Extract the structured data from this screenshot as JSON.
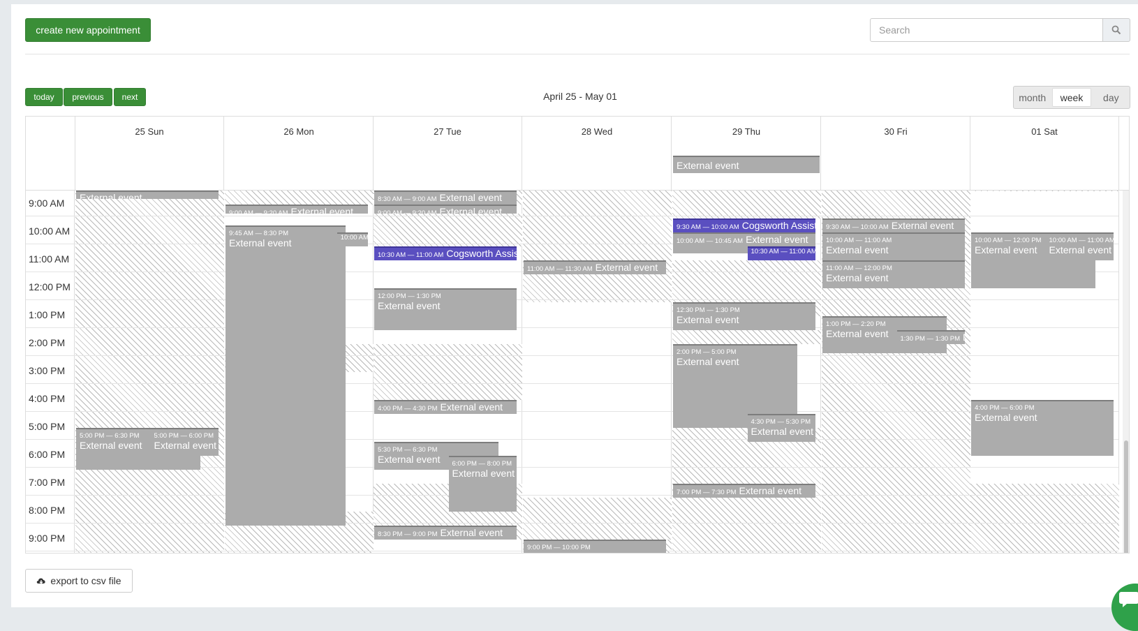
{
  "toolbar": {
    "create_label": "create new appointment",
    "search_placeholder": "Search",
    "today_label": "today",
    "previous_label": "previous",
    "next_label": "next",
    "range_title": "April 25 - May 01",
    "views": [
      "month",
      "week",
      "day"
    ],
    "active_view": "week"
  },
  "calendar": {
    "days": [
      "25 Sun",
      "26 Mon",
      "27 Tue",
      "28 Wed",
      "29 Thu",
      "30 Fri",
      "01 Sat"
    ],
    "hours": [
      "9:00 AM",
      "10:00 AM",
      "11:00 AM",
      "12:00 PM",
      "1:00 PM",
      "2:00 PM",
      "3:00 PM",
      "4:00 PM",
      "5:00 PM",
      "6:00 PM",
      "7:00 PM",
      "8:00 PM",
      "9:00 PM"
    ],
    "all_day_event": {
      "day": 4,
      "title": "External event"
    },
    "events": [
      {
        "day": 0,
        "start": 8.3,
        "end": 8.8,
        "time": "",
        "title": "External event",
        "col": 0,
        "cols": 1
      },
      {
        "day": 0,
        "start": 17.0,
        "end": 18.5,
        "time": "5:00 PM — 6:30 PM",
        "title": "External event",
        "col": 0,
        "cols": 2,
        "wide": 1.7
      },
      {
        "day": 0,
        "start": 17.0,
        "end": 18.0,
        "time": "5:00 PM — 6:00 PM",
        "title": "External event",
        "col": 1,
        "cols": 2
      },
      {
        "day": 1,
        "start": 9.0,
        "end": 9.333,
        "time": "9:00 AM — 9:20 AM",
        "title": "External event",
        "col": 0,
        "cols": 1,
        "inline": true
      },
      {
        "day": 1,
        "start": 9.75,
        "end": 20.5,
        "time": "9:45 AM — 8:30 PM",
        "title": "External event",
        "col": 0,
        "cols": 1,
        "partial": 0.82
      },
      {
        "day": 1,
        "start": 10.0,
        "end": 10.5,
        "time": "10:00 AM — 10:30 AM",
        "title": "",
        "col": 1,
        "cols": 2,
        "inline": true,
        "offset": 0.5,
        "wide": 0.5
      },
      {
        "day": 2,
        "start": 8.5,
        "end": 9.0,
        "time": "8:30 AM — 9:00 AM",
        "title": "External event",
        "col": 0,
        "cols": 1,
        "inline": true
      },
      {
        "day": 2,
        "start": 9.0,
        "end": 9.333,
        "time": "9:00 AM — 9:20 AM",
        "title": "External event",
        "col": 0,
        "cols": 1,
        "inline": true
      },
      {
        "day": 2,
        "start": 10.5,
        "end": 11.0,
        "time": "10:30 AM — 11:00 AM",
        "title": "Cogsworth Assistant",
        "col": 0,
        "cols": 1,
        "inline": true,
        "purple": true
      },
      {
        "day": 2,
        "start": 12.0,
        "end": 13.5,
        "time": "12:00 PM — 1:30 PM",
        "title": "External event",
        "col": 0,
        "cols": 1
      },
      {
        "day": 2,
        "start": 16.0,
        "end": 16.5,
        "time": "4:00 PM — 4:30 PM",
        "title": "External event",
        "col": 0,
        "cols": 1,
        "inline": true
      },
      {
        "day": 2,
        "start": 17.5,
        "end": 18.5,
        "time": "5:30 PM — 6:30 PM",
        "title": "External event",
        "col": 0,
        "cols": 1,
        "partial": 0.85
      },
      {
        "day": 2,
        "start": 18.0,
        "end": 20.0,
        "time": "6:00 PM — 8:00 PM",
        "title": "External event",
        "col": 1,
        "cols": 2
      },
      {
        "day": 2,
        "start": 20.5,
        "end": 21.0,
        "time": "8:30 PM — 9:00 PM",
        "title": "External event",
        "col": 0,
        "cols": 1,
        "inline": true
      },
      {
        "day": 3,
        "start": 11.0,
        "end": 11.5,
        "time": "11:00 AM — 11:30 AM",
        "title": "External event",
        "col": 0,
        "cols": 1,
        "inline": true
      },
      {
        "day": 3,
        "start": 21.0,
        "end": 22.0,
        "time": "9:00 PM — 10:00 PM",
        "title": "External event",
        "col": 0,
        "cols": 1
      },
      {
        "day": 4,
        "start": 9.5,
        "end": 10.0,
        "time": "9:30 AM — 10:00 AM",
        "title": "Cogsworth Assistant",
        "col": 0,
        "cols": 1,
        "inline": true,
        "purple": true
      },
      {
        "day": 4,
        "start": 10.0,
        "end": 10.75,
        "time": "10:00 AM — 10:45 AM",
        "title": "External event",
        "col": 0,
        "cols": 1,
        "inline": true
      },
      {
        "day": 4,
        "start": 10.5,
        "end": 11.0,
        "time": "10:30 AM — 11:00 AM",
        "title": "",
        "col": 1,
        "cols": 2,
        "inline": true,
        "purple": true
      },
      {
        "day": 4,
        "start": 12.5,
        "end": 13.5,
        "time": "12:30 PM — 1:30 PM",
        "title": "External event",
        "col": 0,
        "cols": 1
      },
      {
        "day": 4,
        "start": 14.0,
        "end": 17.0,
        "time": "2:00 PM — 5:00 PM",
        "title": "External event",
        "col": 0,
        "cols": 1,
        "partial": 0.85
      },
      {
        "day": 4,
        "start": 16.5,
        "end": 17.5,
        "time": "4:30 PM — 5:30 PM",
        "title": "External event",
        "col": 1,
        "cols": 2
      },
      {
        "day": 4,
        "start": 19.0,
        "end": 19.5,
        "time": "7:00 PM — 7:30 PM",
        "title": "External event",
        "col": 0,
        "cols": 1,
        "inline": true
      },
      {
        "day": 5,
        "start": 8.5,
        "end": 8.52,
        "time": "",
        "title": "",
        "col": 0,
        "cols": 1
      },
      {
        "day": 5,
        "start": 9.5,
        "end": 10.0,
        "time": "9:30 AM — 10:00 AM",
        "title": "External event",
        "col": 0,
        "cols": 1,
        "inline": true
      },
      {
        "day": 5,
        "start": 10.0,
        "end": 11.0,
        "time": "10:00 AM — 11:00 AM",
        "title": "External event",
        "col": 0,
        "cols": 1
      },
      {
        "day": 5,
        "start": 11.0,
        "end": 12.0,
        "time": "11:00 AM — 12:00 PM",
        "title": "External event",
        "col": 0,
        "cols": 1
      },
      {
        "day": 5,
        "start": 13.0,
        "end": 14.333,
        "time": "1:00 PM — 2:20 PM",
        "title": "External event",
        "col": 0,
        "cols": 1,
        "partial": 0.85
      },
      {
        "day": 5,
        "start": 13.5,
        "end": 14.0,
        "time": "1:30 PM — 1:30 PM",
        "title": "External event",
        "col": 1,
        "cols": 2,
        "inline": true
      },
      {
        "day": 6,
        "start": 10.0,
        "end": 12.0,
        "time": "10:00 AM — 12:00 PM",
        "title": "External event",
        "col": 0,
        "cols": 2,
        "wide": 1.7
      },
      {
        "day": 6,
        "start": 10.0,
        "end": 11.0,
        "time": "10:00 AM — 11:00 AM",
        "title": "External event",
        "col": 1,
        "cols": 2
      },
      {
        "day": 6,
        "start": 16.0,
        "end": 18.0,
        "time": "4:00 PM — 6:00 PM",
        "title": "External event",
        "col": 0,
        "cols": 1
      }
    ],
    "unavailable": [
      {
        "day": 0,
        "start": 8.3,
        "end": 22.0
      },
      {
        "day": 1,
        "start": 8.3,
        "end": 9.0
      },
      {
        "day": 1,
        "start": 14.0,
        "end": 15.0
      },
      {
        "day": 1,
        "start": 20.0,
        "end": 22.0
      },
      {
        "day": 2,
        "start": 8.3,
        "end": 9.0
      },
      {
        "day": 2,
        "start": 9.333,
        "end": 10.5
      },
      {
        "day": 2,
        "start": 14.0,
        "end": 16.0
      },
      {
        "day": 2,
        "start": 19.0,
        "end": 21.0
      },
      {
        "day": 3,
        "start": 8.3,
        "end": 12.5
      },
      {
        "day": 3,
        "start": 19.5,
        "end": 21.0
      },
      {
        "day": 3,
        "start": 21.0,
        "end": 22.0
      },
      {
        "day": 4,
        "start": 8.3,
        "end": 9.5
      },
      {
        "day": 4,
        "start": 11.0,
        "end": 13.0
      },
      {
        "day": 4,
        "start": 13.5,
        "end": 14.0
      },
      {
        "day": 4,
        "start": 17.0,
        "end": 22.0
      },
      {
        "day": 5,
        "start": 8.3,
        "end": 22.0
      },
      {
        "day": 6,
        "start": 8.3,
        "end": 8.52
      },
      {
        "day": 6,
        "start": 19.0,
        "end": 22.0
      }
    ]
  },
  "footer": {
    "export_label": "export to csv file"
  }
}
